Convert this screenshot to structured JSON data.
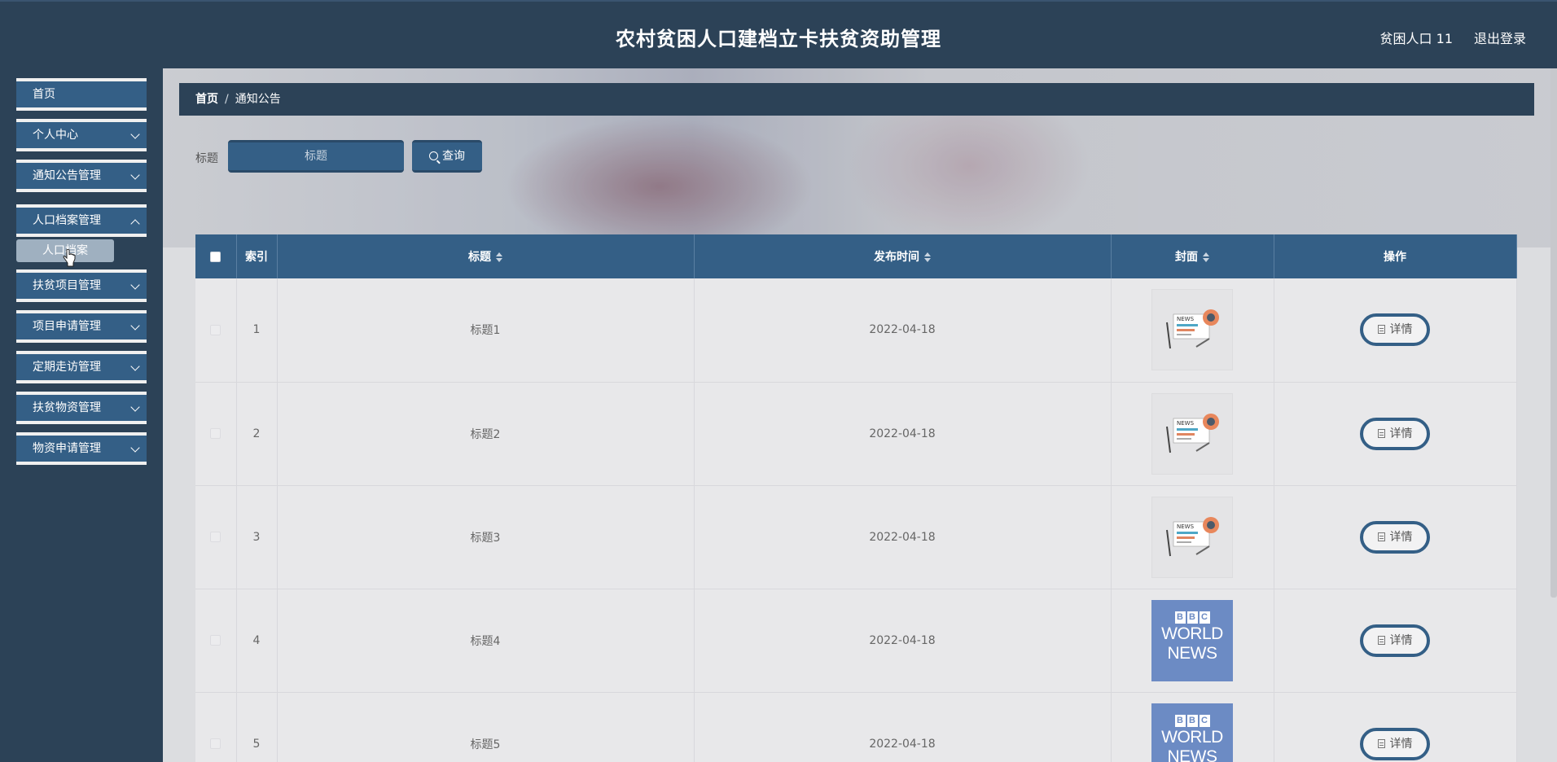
{
  "header": {
    "title": "农村贫困人口建档立卡扶贫资助管理",
    "user": "贫困人口 11",
    "logout": "退出登录"
  },
  "sidebar": {
    "items": [
      {
        "label": "首页"
      },
      {
        "label": "个人中心"
      },
      {
        "label": "通知公告管理"
      },
      {
        "label": "人口档案管理"
      },
      {
        "label": "扶贫项目管理"
      },
      {
        "label": "项目申请管理"
      },
      {
        "label": "定期走访管理"
      },
      {
        "label": "扶贫物资管理"
      },
      {
        "label": "物资申请管理"
      }
    ],
    "submenu": {
      "label": "人口档案"
    }
  },
  "breadcrumb": {
    "home": "首页",
    "separator": "/",
    "current": "通知公告"
  },
  "search": {
    "label": "标题",
    "placeholder": "标题",
    "button": "查询"
  },
  "table": {
    "columns": {
      "index": "索引",
      "title": "标题",
      "time": "发布时间",
      "cover": "封面",
      "action": "操作"
    },
    "detail_label": "详情",
    "rows": [
      {
        "index": "1",
        "title": "标题1",
        "time": "2022-04-18",
        "cover": "news-icon"
      },
      {
        "index": "2",
        "title": "标题2",
        "time": "2022-04-18",
        "cover": "news-icon"
      },
      {
        "index": "3",
        "title": "标题3",
        "time": "2022-04-18",
        "cover": "news-icon"
      },
      {
        "index": "4",
        "title": "标题4",
        "time": "2022-04-18",
        "cover": "bbc-logo"
      },
      {
        "index": "5",
        "title": "标题5",
        "time": "2022-04-18",
        "cover": "bbc-logo"
      }
    ],
    "bbc_text": {
      "letters": [
        "B",
        "B",
        "C"
      ],
      "line1": "WORLD",
      "line2": "NEWS"
    }
  },
  "colors": {
    "header_bg": "#2c4257",
    "accent": "#345f86",
    "menu_border": "#f0f0f0"
  }
}
